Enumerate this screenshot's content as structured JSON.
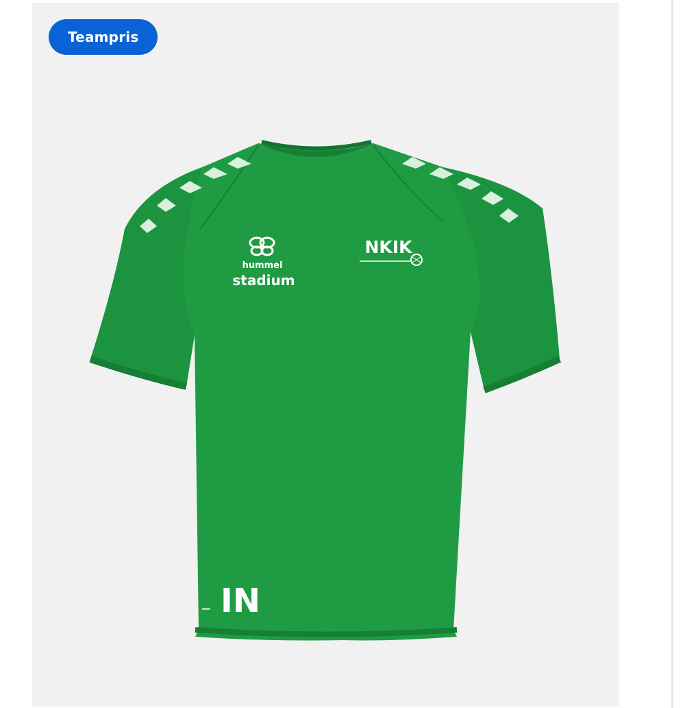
{
  "badge": {
    "label": "Teampris"
  },
  "product": {
    "brand_logo_text": "hummel",
    "sponsor_text": "stadium",
    "club_logo_text": "NKIK",
    "initials": "IN",
    "shirt_color": "#1d9a42",
    "shirt_dark": "#168236"
  },
  "colors": {
    "badge_bg": "#0a63d6",
    "card_bg": "#f1f1f1"
  },
  "icons": {
    "brand_logo": "hummel-bee-icon",
    "club_ball": "handball-icon"
  }
}
